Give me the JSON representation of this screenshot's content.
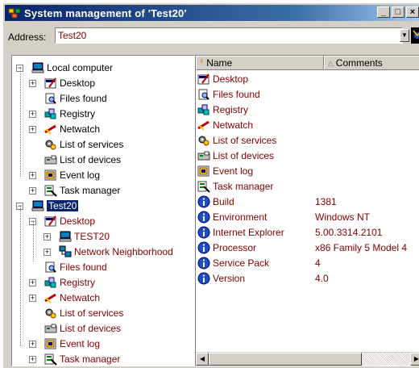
{
  "window": {
    "title": "System management of 'Test20'",
    "btn_min": "_",
    "btn_max": "□",
    "btn_close": "×"
  },
  "address": {
    "label": "Address:",
    "value": "Test20",
    "drop": "▼"
  },
  "tree": [
    {
      "label": "Local computer",
      "icon": "computer-icon",
      "level": 0,
      "exp": "−"
    },
    {
      "label": "Desktop",
      "icon": "desktop-icon",
      "level": 1,
      "exp": "+"
    },
    {
      "label": "Files found",
      "icon": "search-icon",
      "level": 1,
      "exp": ""
    },
    {
      "label": "Registry",
      "icon": "registry-icon",
      "level": 1,
      "exp": "+"
    },
    {
      "label": "Netwatch",
      "icon": "netwatch-icon",
      "level": 1,
      "exp": "+"
    },
    {
      "label": "List of services",
      "icon": "services-icon",
      "level": 1,
      "exp": ""
    },
    {
      "label": "List of devices",
      "icon": "devices-icon",
      "level": 1,
      "exp": ""
    },
    {
      "label": "Event log",
      "icon": "eventlog-icon",
      "level": 1,
      "exp": "+"
    },
    {
      "label": "Task manager",
      "icon": "taskmanager-icon",
      "level": 1,
      "exp": "+"
    },
    {
      "label": "Test20",
      "icon": "computer-icon",
      "level": 0,
      "exp": "−",
      "selected": true
    },
    {
      "label": "Desktop",
      "icon": "desktop-icon",
      "level": 1,
      "exp": "−",
      "remote": true
    },
    {
      "label": "TEST20",
      "icon": "computer-icon",
      "level": 2,
      "exp": "+",
      "remote": true
    },
    {
      "label": "Network Neighborhood",
      "icon": "network-icon",
      "level": 2,
      "exp": "+",
      "remote": true
    },
    {
      "label": "Files found",
      "icon": "search-icon",
      "level": 1,
      "exp": "",
      "remote": true
    },
    {
      "label": "Registry",
      "icon": "registry-icon",
      "level": 1,
      "exp": "+",
      "remote": true
    },
    {
      "label": "Netwatch",
      "icon": "netwatch-icon",
      "level": 1,
      "exp": "+",
      "remote": true
    },
    {
      "label": "List of services",
      "icon": "services-icon",
      "level": 1,
      "exp": "",
      "remote": true
    },
    {
      "label": "List of devices",
      "icon": "devices-icon",
      "level": 1,
      "exp": "",
      "remote": true
    },
    {
      "label": "Event log",
      "icon": "eventlog-icon",
      "level": 1,
      "exp": "+",
      "remote": true
    },
    {
      "label": "Task manager",
      "icon": "taskmanager-icon",
      "level": 1,
      "exp": "+",
      "remote": true
    }
  ],
  "list": {
    "columns": [
      "Name",
      "Comments"
    ],
    "rows": [
      {
        "name": "Desktop",
        "icon": "desktop-icon",
        "comment": ""
      },
      {
        "name": "Files found",
        "icon": "search-icon",
        "comment": ""
      },
      {
        "name": "Registry",
        "icon": "registry-icon",
        "comment": ""
      },
      {
        "name": "Netwatch",
        "icon": "netwatch-icon",
        "comment": ""
      },
      {
        "name": "List of services",
        "icon": "services-icon",
        "comment": ""
      },
      {
        "name": "List of devices",
        "icon": "devices-icon",
        "comment": ""
      },
      {
        "name": "Event log",
        "icon": "eventlog-icon",
        "comment": ""
      },
      {
        "name": "Task manager",
        "icon": "taskmanager-icon",
        "comment": ""
      },
      {
        "name": "Build",
        "icon": "info-icon",
        "comment": "1381"
      },
      {
        "name": "Environment",
        "icon": "info-icon",
        "comment": "Windows NT"
      },
      {
        "name": "Internet Explorer",
        "icon": "info-icon",
        "comment": "5.00.3314.2101"
      },
      {
        "name": "Processor",
        "icon": "info-icon",
        "comment": "x86 Family 5 Model 4"
      },
      {
        "name": "Service Pack",
        "icon": "info-icon",
        "comment": "4"
      },
      {
        "name": "Version",
        "icon": "info-icon",
        "comment": "4.0"
      }
    ]
  },
  "colors": {
    "title_bar": "#0a246a",
    "selection": "#0a246a",
    "remote_text": "#800000",
    "info_icon": "#1f4fbf"
  }
}
